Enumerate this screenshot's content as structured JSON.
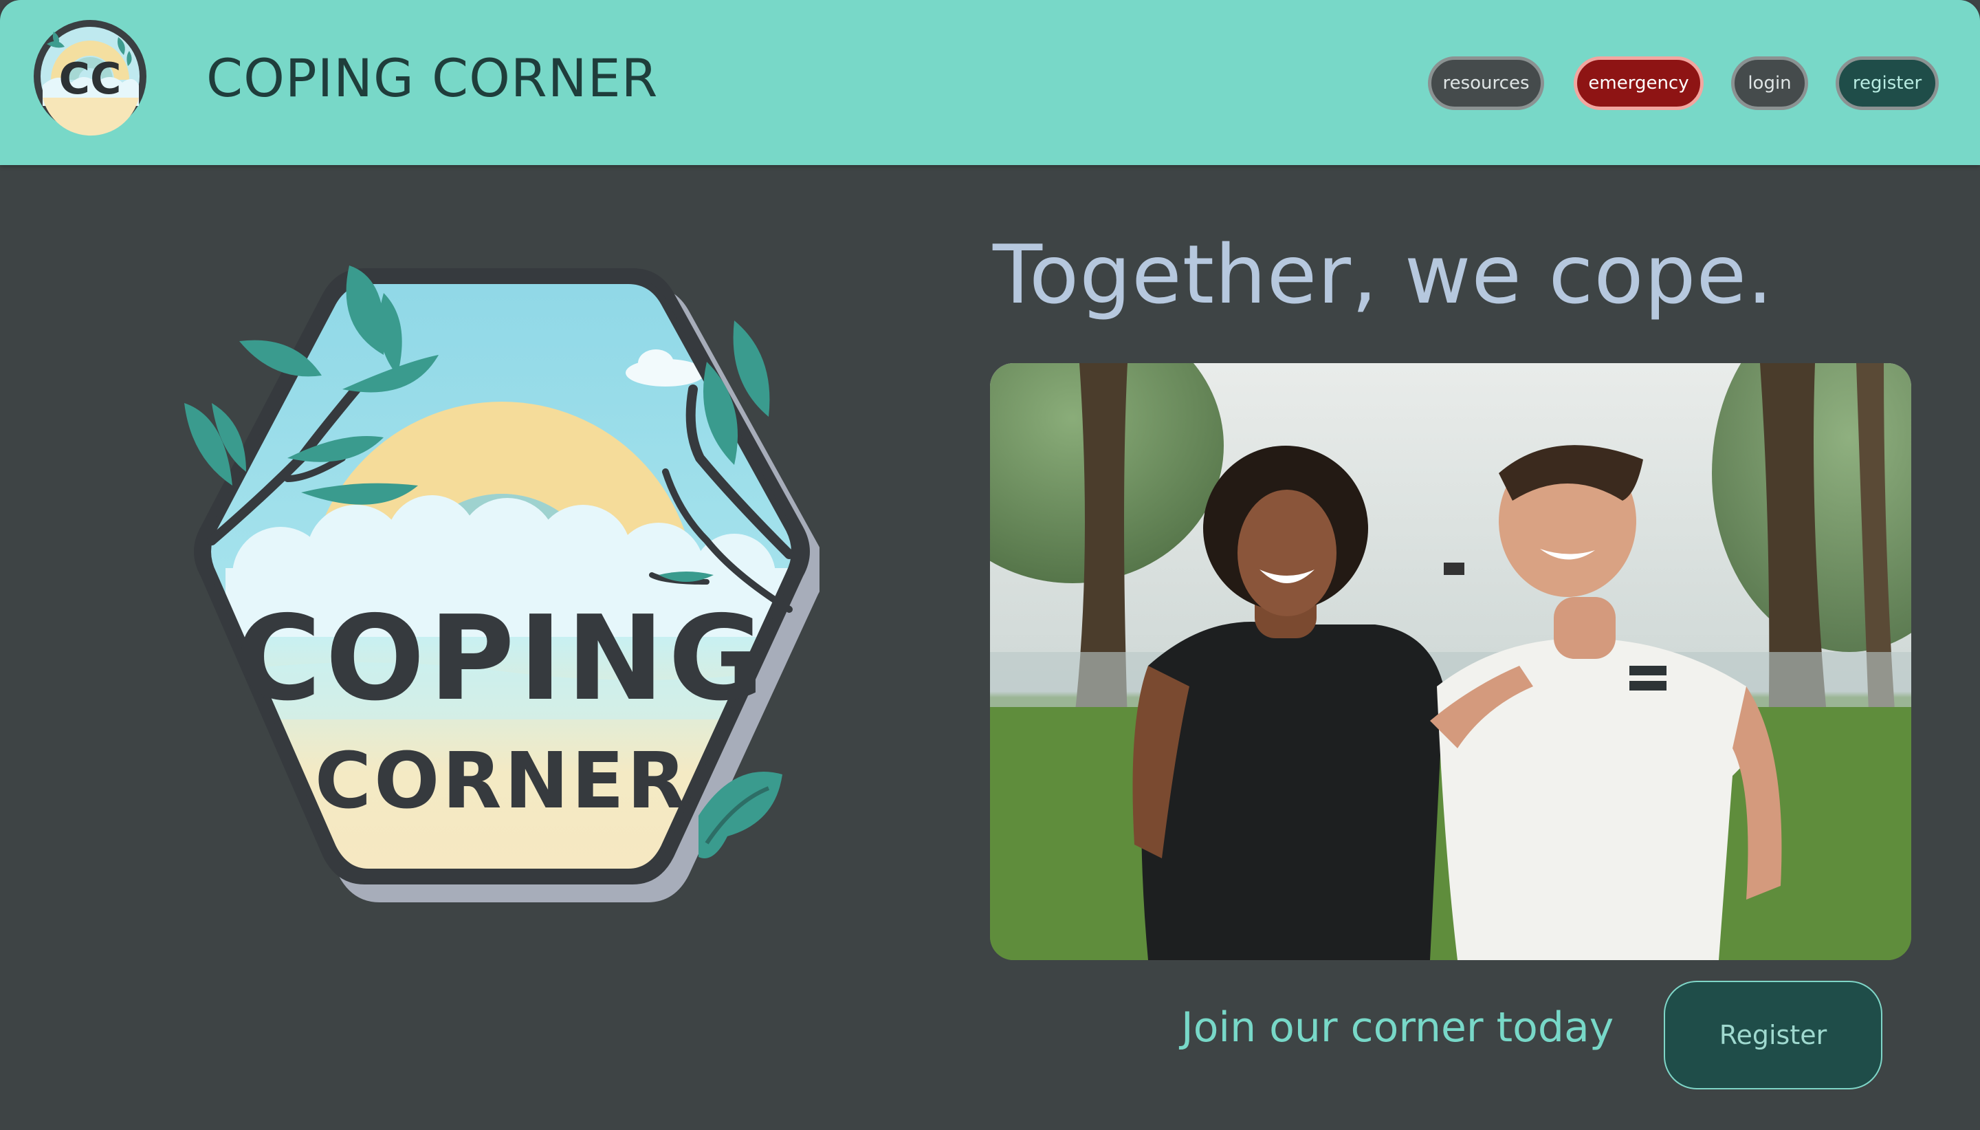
{
  "header": {
    "logo_text": "CC",
    "site_title": "COPING CORNER",
    "nav": {
      "resources": "resources",
      "emergency": "emergency",
      "login": "login",
      "register": "register"
    }
  },
  "hero": {
    "logo_line1": "COPING",
    "logo_line2": "CORNER",
    "tagline": "Together, we cope.",
    "join_text": "Join our corner today",
    "register_button": "Register"
  },
  "colors": {
    "header_bg": "#78d8c8",
    "page_bg": "#3e4445",
    "emergency": "#8e1414",
    "accent_dark": "#1f4d49"
  }
}
